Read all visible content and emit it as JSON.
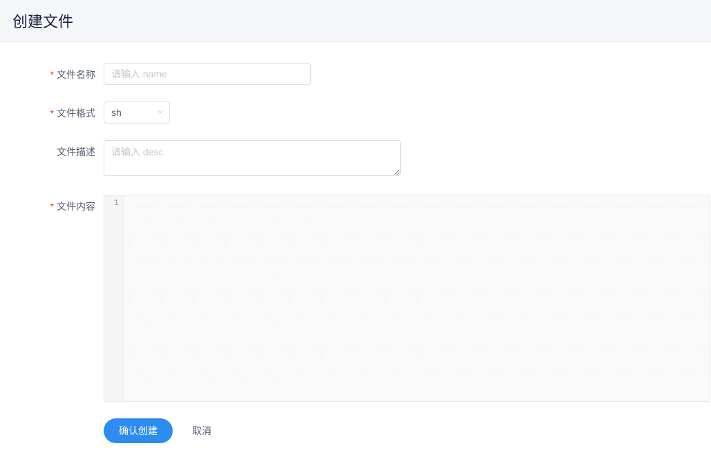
{
  "header": {
    "title": "创建文件"
  },
  "form": {
    "filename": {
      "label": "文件名称",
      "placeholder": "请输入 name",
      "value": ""
    },
    "format": {
      "label": "文件格式",
      "selected": "sh"
    },
    "description": {
      "label": "文件描述",
      "placeholder": "请输入 desc",
      "value": ""
    },
    "content": {
      "label": "文件内容",
      "line_number": "1",
      "value": ""
    }
  },
  "buttons": {
    "confirm": "确认创建",
    "cancel": "取消"
  }
}
